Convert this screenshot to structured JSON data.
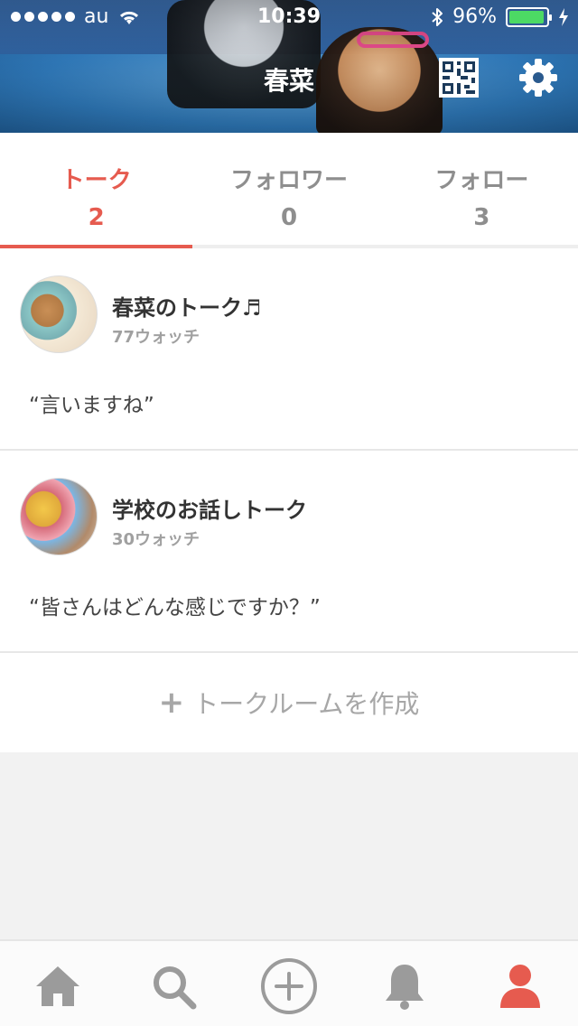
{
  "status_bar": {
    "carrier": "au",
    "time": "10:39",
    "battery_percent": "96%",
    "battery_level": 0.96
  },
  "header": {
    "profile_name": "春菜"
  },
  "tabs": [
    {
      "label": "トーク",
      "count": "2",
      "active": true
    },
    {
      "label": "フォロワー",
      "count": "0",
      "active": false
    },
    {
      "label": "フォロー",
      "count": "3",
      "active": false
    }
  ],
  "talks": [
    {
      "title": "春菜のトーク♬",
      "watch": "77ウォッチ",
      "quote": "“言いますね”"
    },
    {
      "title": "学校のお話しトーク",
      "watch": "30ウォッチ",
      "quote": "“皆さんはどんな感じですか？”"
    }
  ],
  "create_talk": {
    "plus": "+",
    "label": "トークルームを作成"
  },
  "bottom_nav": {
    "items": [
      "home-icon",
      "search-icon",
      "add-circle-icon",
      "bell-icon",
      "profile-icon"
    ],
    "active_item": "profile-icon"
  },
  "colors": {
    "accent": "#e65b4f",
    "muted": "#8e8e8e"
  }
}
